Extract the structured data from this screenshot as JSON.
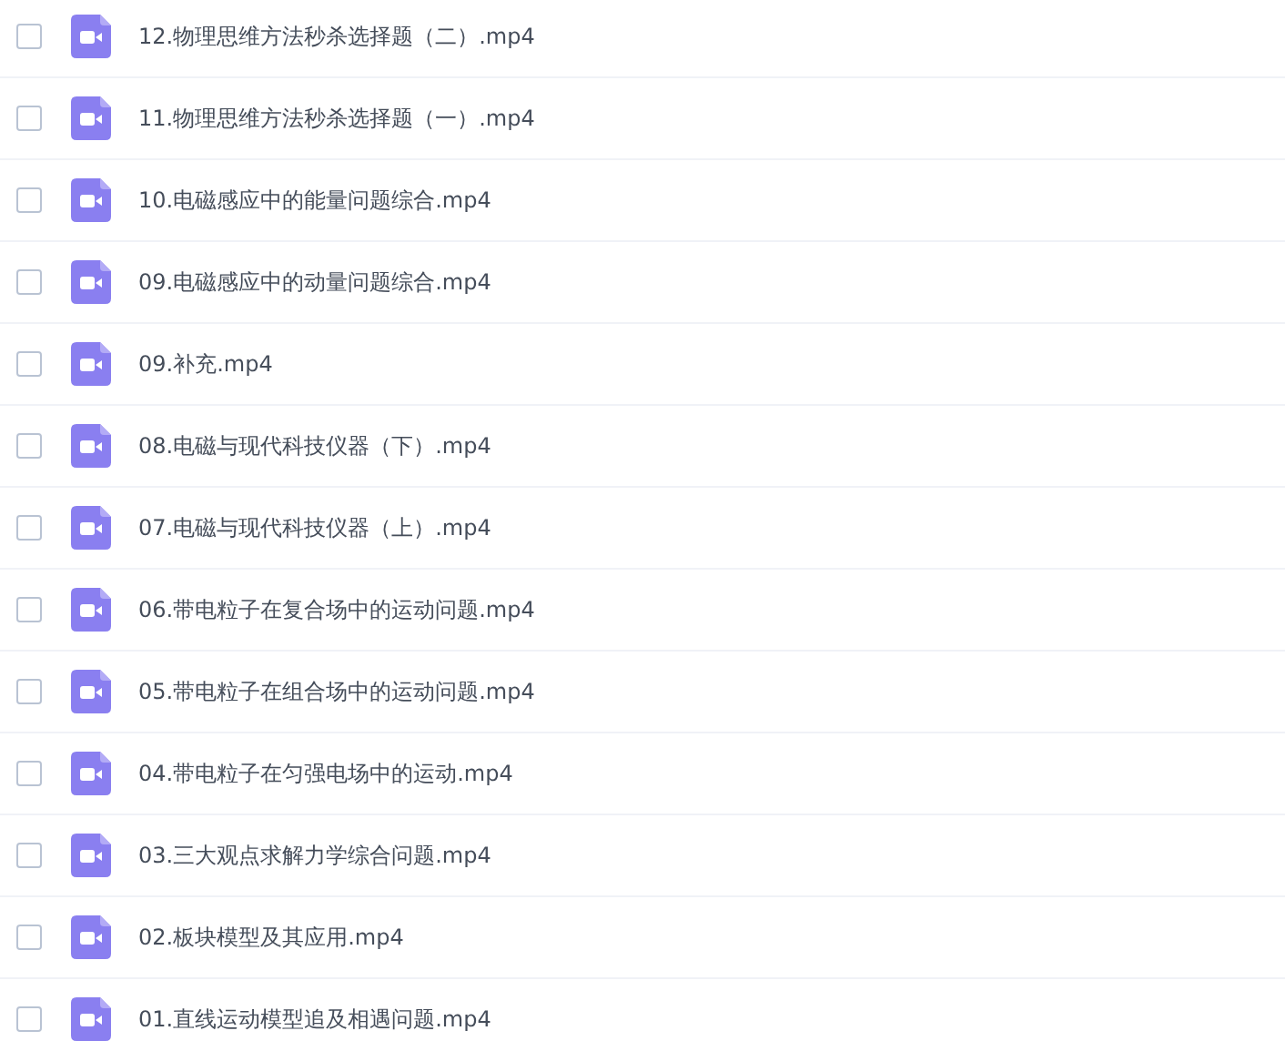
{
  "files": [
    {
      "name": "12.物理思维方法秒杀选择题（二）.mp4",
      "checked": false
    },
    {
      "name": "11.物理思维方法秒杀选择题（一）.mp4",
      "checked": false
    },
    {
      "name": "10.电磁感应中的能量问题综合.mp4",
      "checked": false
    },
    {
      "name": "09.电磁感应中的动量问题综合.mp4",
      "checked": false
    },
    {
      "name": "09.补充.mp4",
      "checked": false
    },
    {
      "name": "08.电磁与现代科技仪器（下）.mp4",
      "checked": false
    },
    {
      "name": "07.电磁与现代科技仪器（上）.mp4",
      "checked": false
    },
    {
      "name": "06.带电粒子在复合场中的运动问题.mp4",
      "checked": false
    },
    {
      "name": "05.带电粒子在组合场中的运动问题.mp4",
      "checked": false
    },
    {
      "name": "04.带电粒子在匀强电场中的运动.mp4",
      "checked": false
    },
    {
      "name": "03.三大观点求解力学综合问题.mp4",
      "checked": false
    },
    {
      "name": "02.板块模型及其应用.mp4",
      "checked": false
    },
    {
      "name": "01.直线运动模型追及相遇问题.mp4",
      "checked": false
    }
  ]
}
